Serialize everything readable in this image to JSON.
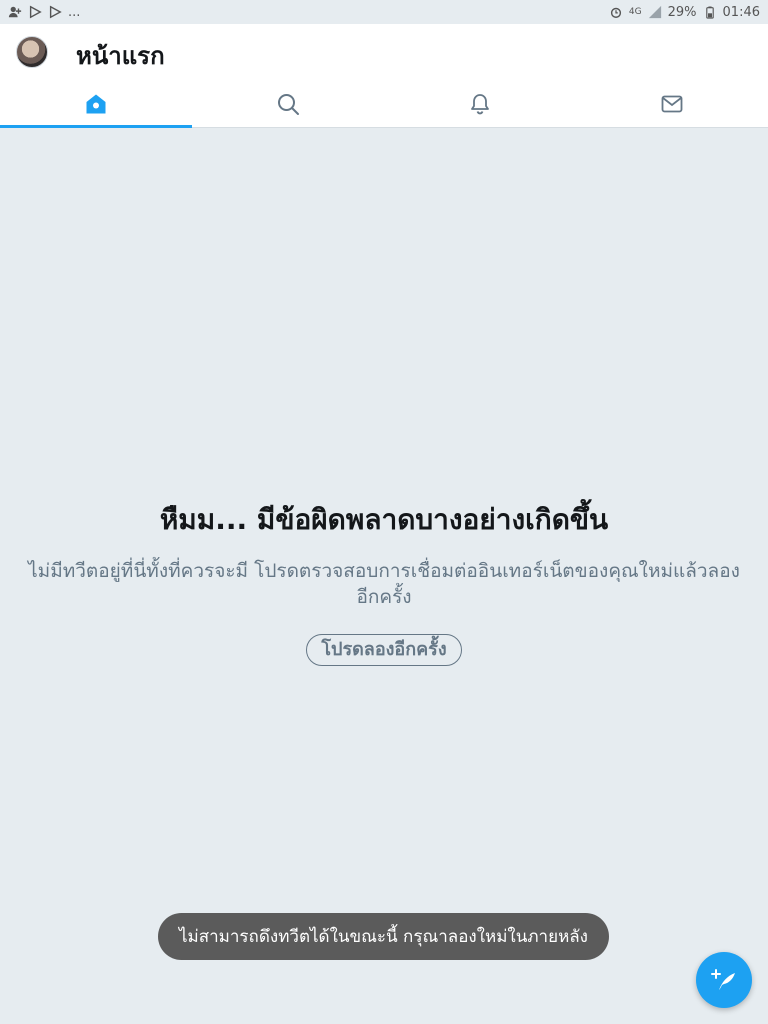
{
  "status_bar": {
    "notifications": [
      "add-user-icon",
      "play-icon",
      "play-icon"
    ],
    "overflow": "...",
    "network": "4G",
    "battery": "29%",
    "time": "01:46"
  },
  "header": {
    "title": "หน้าแรก",
    "tabs": [
      {
        "name": "home",
        "icon": "home-icon",
        "active": true
      },
      {
        "name": "search",
        "icon": "search-icon",
        "active": false
      },
      {
        "name": "notifications",
        "icon": "bell-icon",
        "active": false
      },
      {
        "name": "messages",
        "icon": "mail-icon",
        "active": false
      }
    ]
  },
  "main": {
    "error_title": "หืมม... มีข้อผิดพลาดบางอย่างเกิดขึ้น",
    "error_description": "ไม่มีทวีตอยู่ที่นี่ทั้งที่ควรจะมี โปรดตรวจสอบการเชื่อมต่ออินเทอร์เน็ตของคุณใหม่แล้วลองอีกครั้ง",
    "retry_label": "โปรดลองอีกครั้ง"
  },
  "toast": {
    "message": "ไม่สามารถดึงทวีตได้ในขณะนี้ กรุณาลองใหม่ในภายหลัง"
  },
  "fab": {
    "icon": "compose-tweet-icon"
  },
  "colors": {
    "accent": "#1da1f2",
    "background": "#e6ecf0",
    "muted_text": "#657786",
    "toast_bg": "#5b5b5b"
  }
}
